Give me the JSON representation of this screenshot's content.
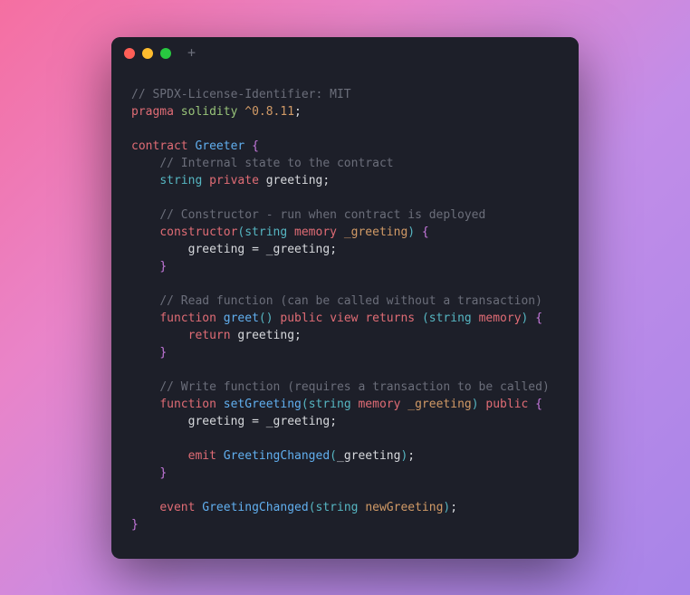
{
  "window": {
    "plus_symbol": "+"
  },
  "code": {
    "l1_comment": "// SPDX-License-Identifier: MIT",
    "l2_pragma": "pragma",
    "l2_solidity": "solidity",
    "l2_version": "^0.8.11",
    "l2_semi": ";",
    "l4_contract": "contract",
    "l4_name": "Greeter",
    "l4_brace": "{",
    "l5_comment": "// Internal state to the contract",
    "l6_string": "string",
    "l6_private": "private",
    "l6_greeting": "greeting",
    "l6_semi": ";",
    "l8_comment": "// Constructor - run when contract is deployed",
    "l9_constructor": "constructor",
    "l9_lparen": "(",
    "l9_string": "string",
    "l9_memory": "memory",
    "l9_param": "_greeting",
    "l9_rparen": ")",
    "l9_brace": " {",
    "l10_greeting": "greeting",
    "l10_eq": " = ",
    "l10_param": "_greeting",
    "l10_semi": ";",
    "l11_brace": "}",
    "l13_comment": "// Read function (can be called without a transaction)",
    "l14_function": "function",
    "l14_name": "greet",
    "l14_lparen": "(",
    "l14_rparen": ")",
    "l14_public": "public",
    "l14_view": "view",
    "l14_returns": "returns",
    "l14_lparen2": "(",
    "l14_string": "string",
    "l14_memory": "memory",
    "l14_rparen2": ")",
    "l14_brace": " {",
    "l15_return": "return",
    "l15_greeting": "greeting",
    "l15_semi": ";",
    "l16_brace": "}",
    "l18_comment": "// Write function (requires a transaction to be called)",
    "l19_function": "function",
    "l19_name": "setGreeting",
    "l19_lparen": "(",
    "l19_string": "string",
    "l19_memory": "memory",
    "l19_param": "_greeting",
    "l19_rparen": ")",
    "l19_public": "public",
    "l19_brace": " {",
    "l20_greeting": "greeting",
    "l20_eq": " = ",
    "l20_param": "_greeting",
    "l20_semi": ";",
    "l22_emit": "emit",
    "l22_event": "GreetingChanged",
    "l22_lparen": "(",
    "l22_param": "_greeting",
    "l22_rparen": ")",
    "l22_semi": ";",
    "l23_brace": "}",
    "l25_event": "event",
    "l25_name": "GreetingChanged",
    "l25_lparen": "(",
    "l25_string": "string",
    "l25_param": "newGreeting",
    "l25_rparen": ")",
    "l25_semi": ";",
    "l26_brace": "}"
  }
}
